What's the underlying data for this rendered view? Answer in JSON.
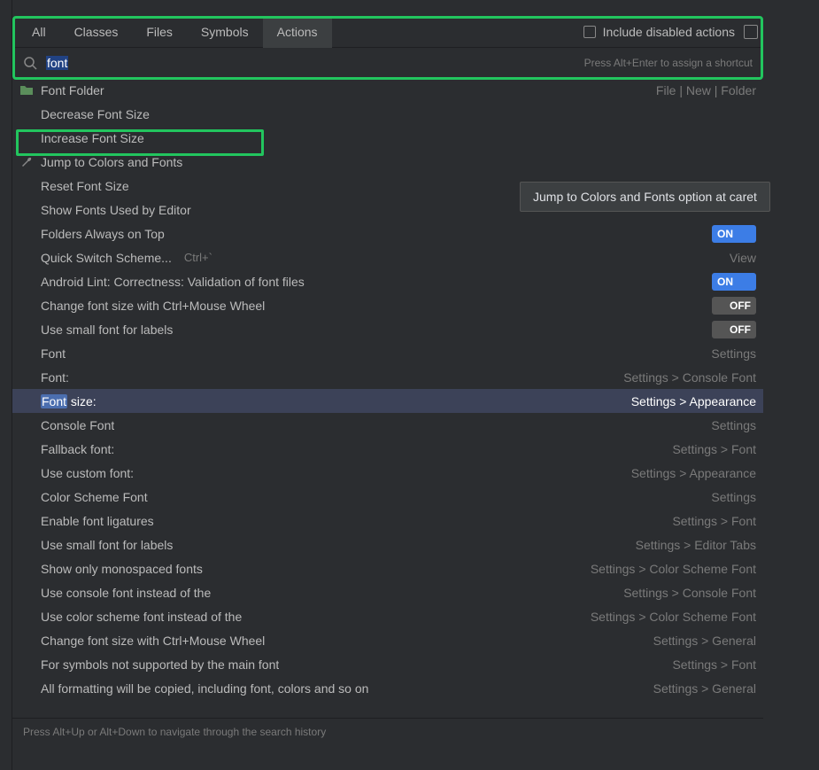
{
  "tabs": [
    "All",
    "Classes",
    "Files",
    "Symbols",
    "Actions"
  ],
  "activeTab": 4,
  "includeDisabled": {
    "label": "Include disabled actions",
    "checked": false
  },
  "search": {
    "value": "font",
    "placeholder": "",
    "hint": "Press Alt+Enter to assign a shortcut"
  },
  "tooltip": "Jump to Colors and Fonts option at caret",
  "footer": "Press Alt+Up or Alt+Down to navigate through the search history",
  "results": [
    {
      "icon": "folder",
      "label": "Font Folder",
      "right": "File | New | Folder"
    },
    {
      "icon": "",
      "label": "Decrease Font Size",
      "right": ""
    },
    {
      "icon": "",
      "label": "Increase Font Size",
      "right": ""
    },
    {
      "icon": "wrench",
      "label": "Jump to Colors and Fonts",
      "right": ""
    },
    {
      "icon": "",
      "label": "Reset Font Size",
      "right": ""
    },
    {
      "icon": "",
      "label": "Show Fonts Used by Editor",
      "right": ""
    },
    {
      "icon": "",
      "label": "Folders Always on Top",
      "right": "",
      "toggle": "on"
    },
    {
      "icon": "",
      "label": "Quick Switch Scheme...",
      "hint": "Ctrl+`",
      "right": "View"
    },
    {
      "icon": "",
      "label": "Android Lint: Correctness: Validation of font files",
      "right": "",
      "toggle": "on"
    },
    {
      "icon": "",
      "label": "Change font size with Ctrl+Mouse Wheel",
      "right": "",
      "toggle": "off"
    },
    {
      "icon": "",
      "label": "Use small font for labels",
      "right": "",
      "toggle": "off"
    },
    {
      "icon": "",
      "label": "Font",
      "right": "Settings"
    },
    {
      "icon": "",
      "label": "Font:",
      "right": "Settings > Console Font"
    },
    {
      "icon": "",
      "labelHtml": "<span class='hl'>Font</span> size:",
      "right": "Settings > Appearance",
      "selected": true
    },
    {
      "icon": "",
      "label": "Console Font",
      "right": "Settings"
    },
    {
      "icon": "",
      "label": "Fallback font:",
      "right": "Settings > Font"
    },
    {
      "icon": "",
      "label": "Use custom font:",
      "right": "Settings > Appearance"
    },
    {
      "icon": "",
      "label": "Color Scheme Font",
      "right": "Settings"
    },
    {
      "icon": "",
      "label": "Enable font ligatures",
      "right": "Settings > Font"
    },
    {
      "icon": "",
      "label": "Use small font for labels",
      "right": "Settings > Editor Tabs"
    },
    {
      "icon": "",
      "label": "Show only monospaced fonts",
      "right": "Settings > Color Scheme Font"
    },
    {
      "icon": "",
      "label": "Use console font instead of the",
      "right": "Settings > Console Font"
    },
    {
      "icon": "",
      "label": "Use color scheme font instead of the",
      "right": "Settings > Color Scheme Font"
    },
    {
      "icon": "",
      "label": "Change font size with Ctrl+Mouse Wheel",
      "right": "Settings > General"
    },
    {
      "icon": "",
      "label": "For symbols not supported by the main font",
      "right": "Settings > Font"
    },
    {
      "icon": "",
      "label": "All formatting will be copied, including font, colors and so on",
      "right": "Settings > General"
    }
  ]
}
